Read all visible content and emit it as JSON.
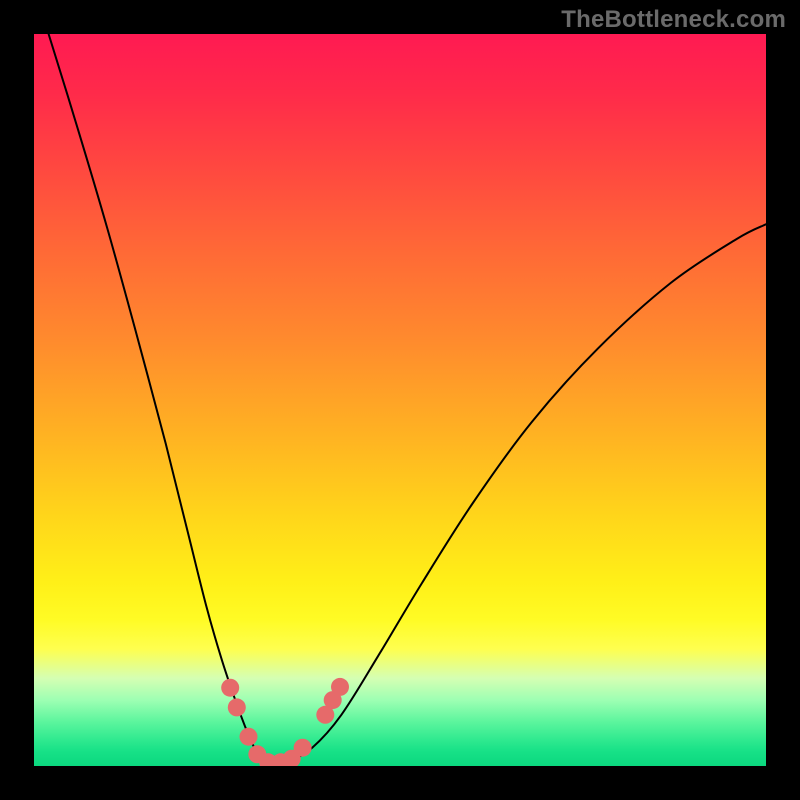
{
  "watermark": {
    "text": "TheBottleneck.com"
  },
  "chart_data": {
    "type": "line",
    "title": "",
    "xlabel": "",
    "ylabel": "",
    "xlim": [
      0,
      1
    ],
    "ylim": [
      0,
      1
    ],
    "background_gradient": {
      "direction": "vertical",
      "stops": [
        {
          "pos": 0.0,
          "color": "#ff1a52"
        },
        {
          "pos": 0.3,
          "color": "#ff6a36"
        },
        {
          "pos": 0.55,
          "color": "#ffb322"
        },
        {
          "pos": 0.75,
          "color": "#fff018"
        },
        {
          "pos": 0.88,
          "color": "#d5ffb3"
        },
        {
          "pos": 1.0,
          "color": "#0bd87f"
        }
      ]
    },
    "series": [
      {
        "name": "bottleneck-curve",
        "color": "#000000",
        "stroke_width": 2,
        "x": [
          0.02,
          0.06,
          0.1,
          0.14,
          0.18,
          0.21,
          0.235,
          0.255,
          0.275,
          0.292,
          0.305,
          0.32,
          0.345,
          0.38,
          0.42,
          0.47,
          0.53,
          0.6,
          0.68,
          0.77,
          0.87,
          0.96,
          1.0
        ],
        "y": [
          1.0,
          0.87,
          0.735,
          0.59,
          0.44,
          0.32,
          0.22,
          0.15,
          0.09,
          0.045,
          0.018,
          0.005,
          0.005,
          0.025,
          0.07,
          0.15,
          0.25,
          0.36,
          0.47,
          0.57,
          0.66,
          0.72,
          0.74
        ]
      }
    ],
    "markers": {
      "name": "highlight-dots",
      "color": "#e66a6a",
      "radius": 9,
      "points": [
        {
          "x": 0.268,
          "y": 0.107
        },
        {
          "x": 0.277,
          "y": 0.08
        },
        {
          "x": 0.293,
          "y": 0.04
        },
        {
          "x": 0.305,
          "y": 0.016
        },
        {
          "x": 0.32,
          "y": 0.005
        },
        {
          "x": 0.337,
          "y": 0.005
        },
        {
          "x": 0.352,
          "y": 0.01
        },
        {
          "x": 0.367,
          "y": 0.025
        },
        {
          "x": 0.398,
          "y": 0.07
        },
        {
          "x": 0.408,
          "y": 0.09
        },
        {
          "x": 0.418,
          "y": 0.108
        }
      ]
    }
  }
}
